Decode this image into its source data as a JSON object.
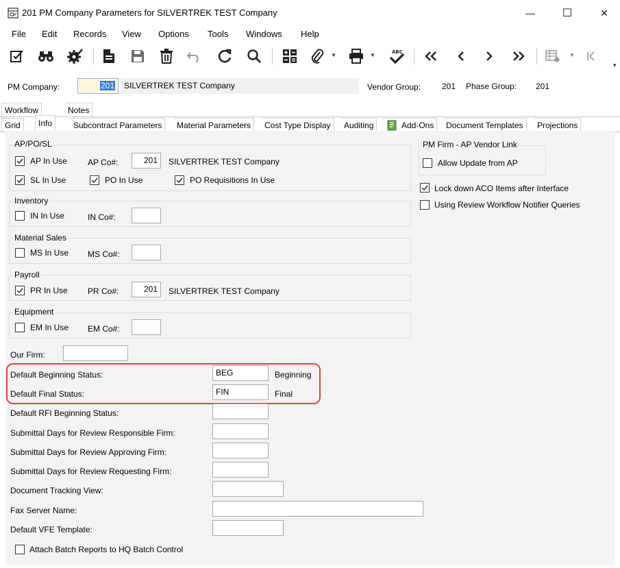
{
  "window": {
    "title": "201 PM Company Parameters for SILVERTREK TEST Company",
    "minimize_glyph": "—",
    "maximize_glyph": "☐",
    "close_glyph": "✕"
  },
  "menu": [
    "File",
    "Edit",
    "Records",
    "View",
    "Options",
    "Tools",
    "Windows",
    "Help"
  ],
  "header": {
    "pm_company_label": "PM Company:",
    "pm_company_value": "201",
    "pm_company_name": "SILVERTREK TEST Company",
    "vendor_group_label": "Vendor Group:",
    "vendor_group_value": "201",
    "phase_group_label": "Phase Group:",
    "phase_group_value": "201"
  },
  "tabs_top": [
    "Workflow",
    "Notes"
  ],
  "tabs": [
    "Grid",
    "Info",
    "Subcontract Parameters",
    "Material Parameters",
    "Cost Type Display",
    "Auditing",
    "Add-Ons",
    "Document Templates",
    "Projections"
  ],
  "active_tab": "Info",
  "ap_po_sl": {
    "title": "AP/PO/SL",
    "ap_in_use_label": "AP In Use",
    "ap_in_use": true,
    "ap_co_label": "AP Co#:",
    "ap_co_value": "201",
    "ap_co_name": "SILVERTREK TEST Company",
    "sl_in_use_label": "SL In Use",
    "sl_in_use": true,
    "po_in_use_label": "PO In Use",
    "po_in_use": true,
    "po_req_label": "PO Requisitions In Use",
    "po_req": true
  },
  "inventory": {
    "title": "Inventory",
    "in_in_use_label": "IN In Use",
    "in_in_use": false,
    "in_co_label": "IN Co#:",
    "in_co_value": ""
  },
  "material_sales": {
    "title": "Material Sales",
    "ms_in_use_label": "MS In Use",
    "ms_in_use": false,
    "ms_co_label": "MS Co#:",
    "ms_co_value": ""
  },
  "payroll": {
    "title": "Payroll",
    "pr_in_use_label": "PR In Use",
    "pr_in_use": true,
    "pr_co_label": "PR Co#:",
    "pr_co_value": "201",
    "pr_co_name": "SILVERTREK TEST Company"
  },
  "equipment": {
    "title": "Equipment",
    "em_in_use_label": "EM In Use",
    "em_in_use": false,
    "em_co_label": "EM Co#:",
    "em_co_value": ""
  },
  "pm_firm": {
    "title": "PM Firm - AP Vendor Link",
    "allow_update_label": "Allow Update from AP",
    "allow_update": false
  },
  "lock_down_label": "Lock down ACO Items after Interface",
  "lock_down": true,
  "review_workflow_label": "Using Review Workflow Notifier Queries",
  "review_workflow": false,
  "form": {
    "our_firm_label": "Our Firm:",
    "our_firm_value": "",
    "default_beginning_status_label": "Default Beginning Status:",
    "default_beginning_status_value": "BEG",
    "default_beginning_status_desc": "Beginning",
    "default_final_status_label": "Default Final Status:",
    "default_final_status_value": "FIN",
    "default_final_status_desc": "Final",
    "rfi_beginning_label": "Default RFI Beginning Status:",
    "rfi_beginning_value": "",
    "sub_days_responsible_label": "Submittal Days for Review Responsible Firm:",
    "sub_days_responsible_value": "",
    "sub_days_approving_label": "Submittal Days for Review Approving Firm:",
    "sub_days_approving_value": "",
    "sub_days_requesting_label": "Submittal Days for Review Requesting Firm:",
    "sub_days_requesting_value": "",
    "doc_tracking_label": "Document Tracking View:",
    "doc_tracking_value": "",
    "fax_server_label": "Fax Server Name:",
    "fax_server_value": "",
    "vfe_template_label": "Default VFE Template:",
    "vfe_template_value": "",
    "attach_batch_label": "Attach Batch Reports to HQ Batch Control",
    "attach_batch": false
  },
  "colors": {
    "highlight": "#d9493a",
    "panel_bg": "#f3f3f3",
    "selection": "#cce4f7"
  }
}
